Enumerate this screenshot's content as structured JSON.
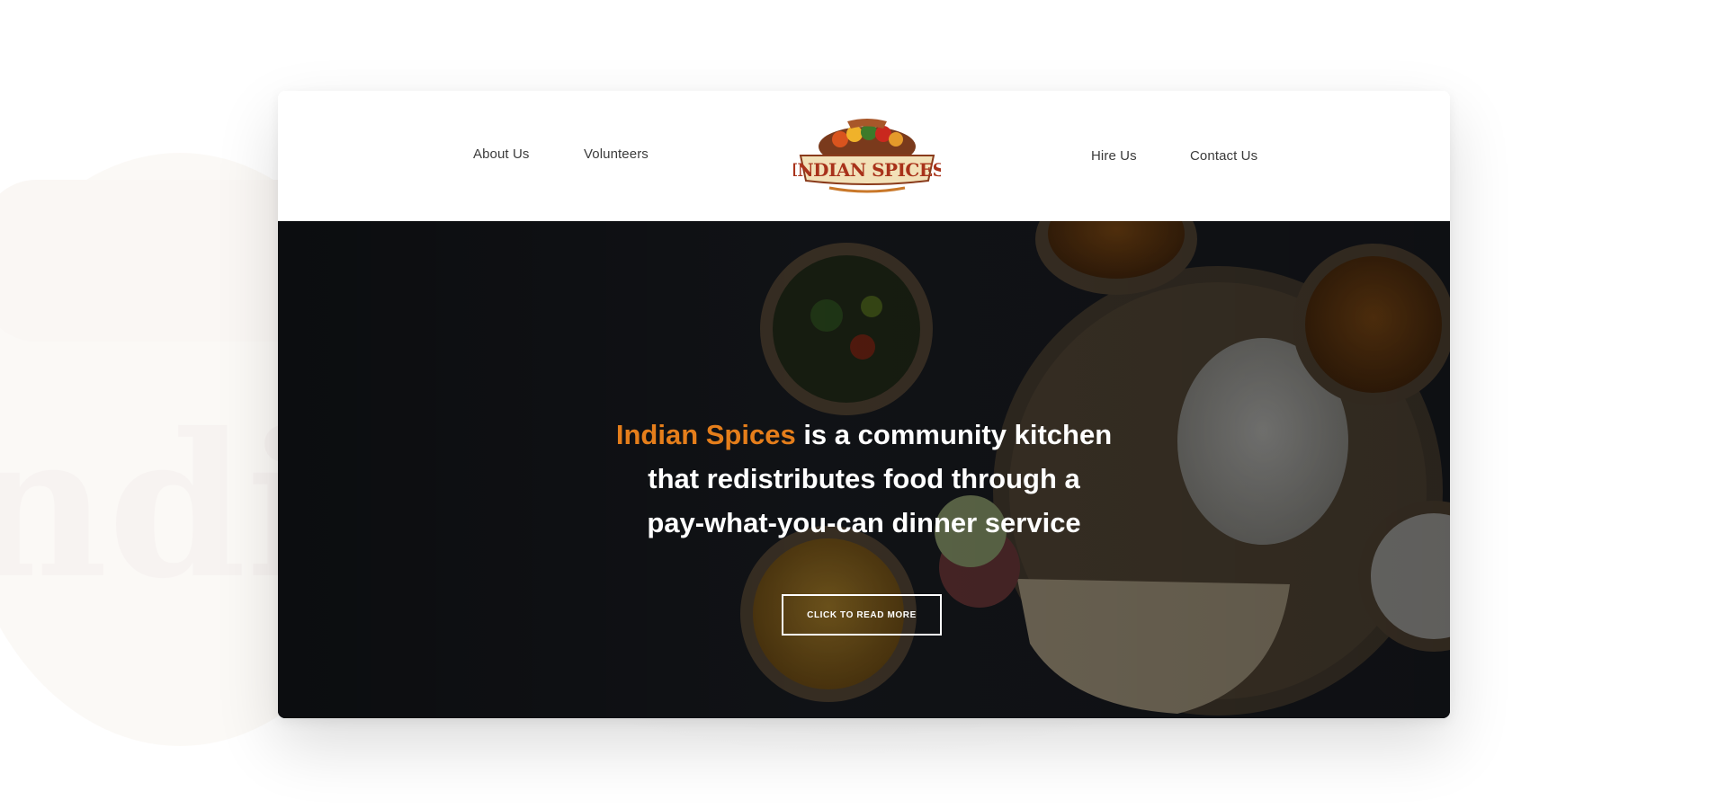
{
  "nav": {
    "about": "About Us",
    "volunteers": "Volunteers",
    "hire": "Hire Us",
    "contact": "Contact Us"
  },
  "logo": {
    "text": "INDIAN SPICES",
    "icon": "indian-spices-logo"
  },
  "hero": {
    "brand": "Indian Spices",
    "line1_rest": " is a community kitchen",
    "line2": "that redistributes food through a",
    "line3": "pay-what-you-can dinner service",
    "cta_label": "CLICK TO READ MORE"
  },
  "colors": {
    "accent": "#e57e1b",
    "hero_bg": "#1d1f25",
    "nav_text": "#3b3b3b"
  }
}
